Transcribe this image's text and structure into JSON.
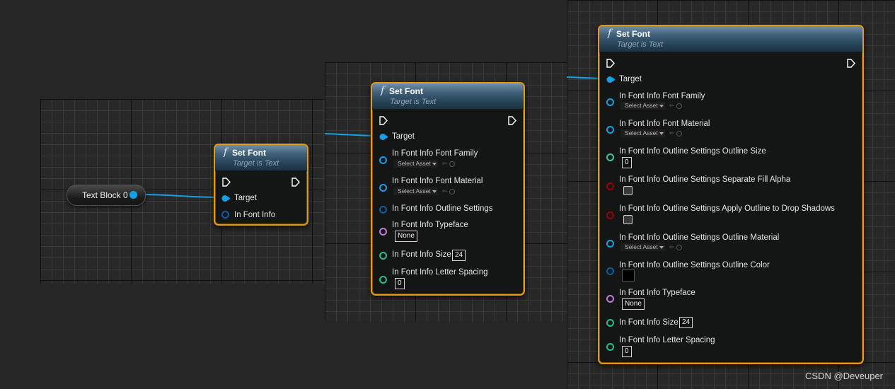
{
  "colors": {
    "object_pin": "#14a0e6",
    "struct_pin": "#0d5ea0",
    "float_pin": "#3ac9a0",
    "int_pin": "#20c08a",
    "bool_pin": "#990000",
    "name_pin": "#c07dd8",
    "node_border": "#e59a14"
  },
  "variable_node": {
    "label": "Text Block 0"
  },
  "node1": {
    "title": "Set Font",
    "subtitle": "Target is Text",
    "pins": {
      "target": "Target",
      "font_info": "In Font Info"
    }
  },
  "node2": {
    "title": "Set Font",
    "subtitle": "Target is Text",
    "pins": {
      "target": "Target",
      "family": "In Font Info Font Family",
      "family_select": "Select Asset",
      "material": "In Font Info Font Material",
      "material_select": "Select Asset",
      "outline": "In Font Info Outline Settings",
      "typeface": "In Font Info Typeface",
      "typeface_value": "None",
      "size": "In Font Info Size",
      "size_value": "24",
      "spacing": "In Font Info Letter Spacing",
      "spacing_value": "0"
    }
  },
  "node3": {
    "title": "Set Font",
    "subtitle": "Target is Text",
    "pins": {
      "target": "Target",
      "family": "In Font Info Font Family",
      "family_select": "Select Asset",
      "material": "In Font Info Font Material",
      "material_select": "Select Asset",
      "outline_size": "In Font Info Outline Settings Outline Size",
      "outline_size_value": "0",
      "separate_fill_alpha": "In Font Info Outline Settings Separate Fill Alpha",
      "apply_outline_shadows": "In Font Info Outline Settings Apply Outline to Drop Shadows",
      "outline_material": "In Font Info Outline Settings Outline Material",
      "outline_material_select": "Select Asset",
      "outline_color": "In Font Info Outline Settings Outline Color",
      "typeface": "In Font Info Typeface",
      "typeface_value": "None",
      "size": "In Font Info Size",
      "size_value": "24",
      "spacing": "In Font Info Letter Spacing",
      "spacing_value": "0"
    }
  },
  "watermark": "CSDN @Deveuper"
}
